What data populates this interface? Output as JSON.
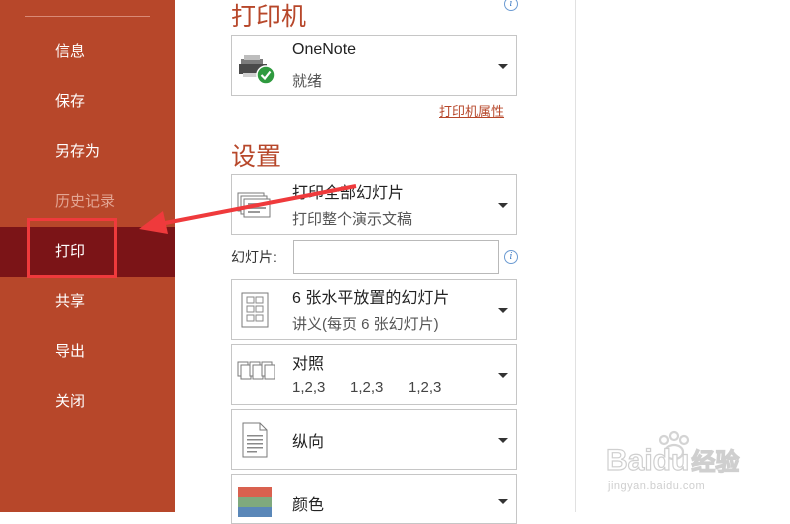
{
  "sidebar": {
    "items": [
      {
        "label": "信息"
      },
      {
        "label": "保存"
      },
      {
        "label": "另存为"
      },
      {
        "label": "历史记录"
      },
      {
        "label": "打印"
      },
      {
        "label": "共享"
      },
      {
        "label": "导出"
      },
      {
        "label": "关闭"
      }
    ]
  },
  "printer": {
    "section_title": "打印机",
    "name": "OneNote",
    "status": "就绪",
    "properties_link": "打印机属性"
  },
  "settings": {
    "section_title": "设置",
    "range": {
      "title": "打印全部幻灯片",
      "subtitle": "打印整个演示文稿"
    },
    "slides_label": "幻灯片:",
    "slides_value": "",
    "layout": {
      "title": "6 张水平放置的幻灯片",
      "subtitle": "讲义(每页 6 张幻灯片)"
    },
    "collation": {
      "title": "对照",
      "sequence": [
        "1,2,3",
        "1,2,3",
        "1,2,3"
      ]
    },
    "orientation": {
      "title": "纵向"
    },
    "color": {
      "title": "颜色"
    }
  },
  "watermark": {
    "brand": "Baidu",
    "brand_cn": "经验",
    "url": "jingyan.baidu.com"
  },
  "colors": {
    "accent": "#b7472a",
    "selected": "#7b1417",
    "annotation": "#ef3a3c"
  }
}
